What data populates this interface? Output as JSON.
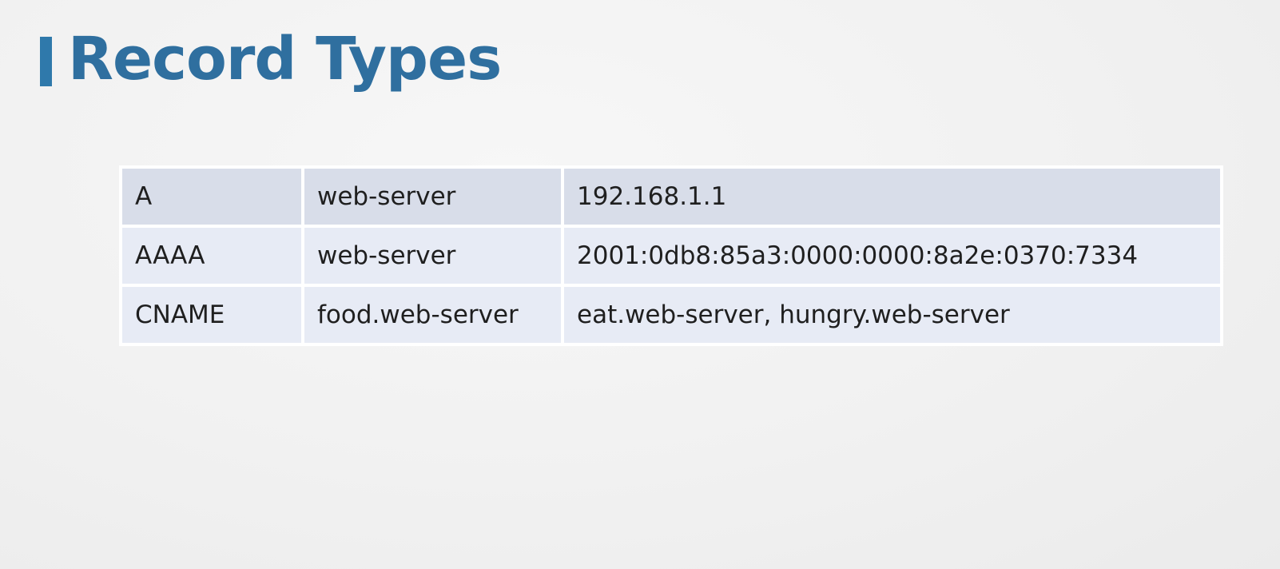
{
  "slide": {
    "title": "Record Types"
  },
  "records_table": {
    "rows": [
      {
        "type": "A",
        "name": "web-server",
        "value": "192.168.1.1"
      },
      {
        "type": "AAAA",
        "name": "web-server",
        "value": "2001:0db8:85a3:0000:0000:8a2e:0370:7334"
      },
      {
        "type": "CNAME",
        "name": "food.web-server",
        "value": "eat.web-server, hungry.web-server"
      }
    ]
  },
  "colors": {
    "title": "#2f6f9f",
    "accent_bar": "#2f79ab",
    "row_dark": "#d8dde9",
    "row_light": "#e7ebf5",
    "cell_border": "#ffffff",
    "text": "#1f1f1f"
  }
}
